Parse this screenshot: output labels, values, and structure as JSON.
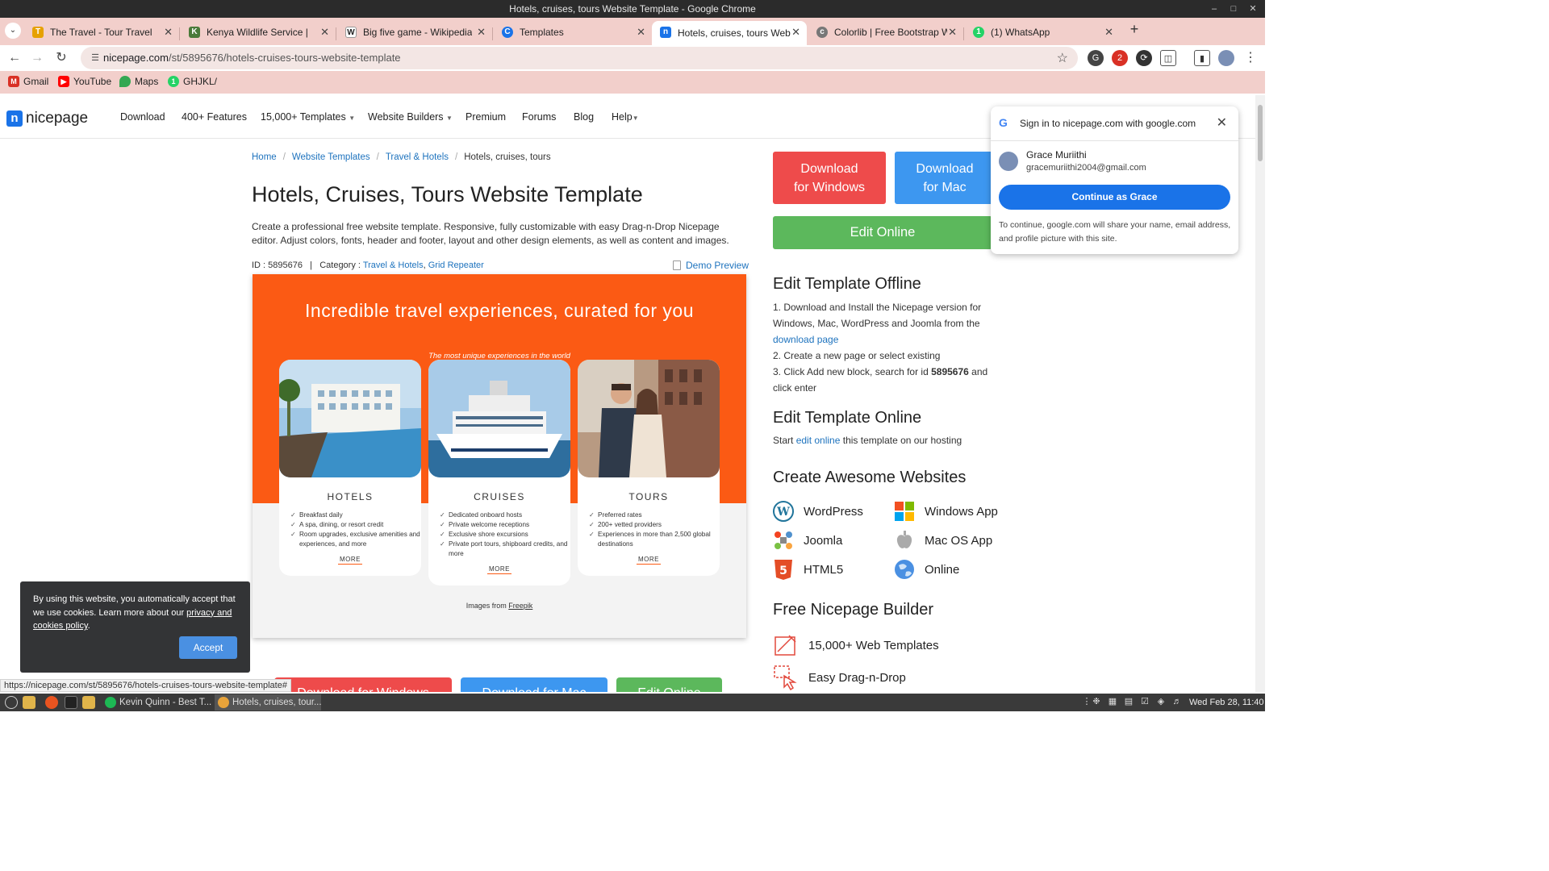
{
  "window": {
    "title": "Hotels, cruises, tours Website Template - Google Chrome"
  },
  "tabs": [
    {
      "label": "The Travel - Tour Travel",
      "favicon": "travel-icon",
      "color": "#e6a100"
    },
    {
      "label": "Kenya Wildlife Service |",
      "favicon": "kws-icon",
      "color": "#4a7a3a"
    },
    {
      "label": "Big five game - Wikipedia",
      "favicon": "wikipedia-icon",
      "color": "#222222"
    },
    {
      "label": "Templates",
      "favicon": "templates-icon",
      "color": "#1a73e8"
    },
    {
      "label": "Hotels, cruises, tours Websit",
      "favicon": "nicepage-icon",
      "color": "#1a73e8",
      "active": true
    },
    {
      "label": "Colorlib | Free Bootstrap We",
      "favicon": "colorlib-icon",
      "color": "#777777"
    },
    {
      "label": "(1) WhatsApp",
      "favicon": "whatsapp-icon",
      "color": "#25d366"
    }
  ],
  "toolbar": {
    "url_host": "nicepage.com",
    "url_path": "/st/5895676/hotels-cruises-tours-website-template",
    "extension_badge": "2"
  },
  "bookmarks": [
    {
      "label": "Gmail",
      "icon": "gmail-icon",
      "color": "#d93025"
    },
    {
      "label": "YouTube",
      "icon": "youtube-icon",
      "color": "#ff0000"
    },
    {
      "label": "Maps",
      "icon": "maps-icon",
      "color": "#34a853"
    },
    {
      "label": "GHJKL/",
      "icon": "whatsapp-icon",
      "color": "#25d366"
    }
  ],
  "site": {
    "logo_text": "nicepage",
    "logo_mark": "n",
    "nav": [
      {
        "label": "Download"
      },
      {
        "label": "400+ Features"
      },
      {
        "label": "15,000+ Templates"
      },
      {
        "label": "Website Builders"
      },
      {
        "label": "Premium"
      },
      {
        "label": "Forums"
      },
      {
        "label": "Blog"
      },
      {
        "label": "Help"
      }
    ]
  },
  "breadcrumb": {
    "home": "Home",
    "templates": "Website Templates",
    "category": "Travel & Hotels",
    "current": "Hotels, cruises, tours"
  },
  "page": {
    "title": "Hotels, Cruises, Tours Website Template",
    "description": "Create a professional free website template. Responsive, fully customizable with easy Drag-n-Drop Nicepage editor. Adjust colors, fonts, header and footer, layout and other design elements, as well as content and images.",
    "id_label": "ID : 5895676",
    "id_sep": "|",
    "category_label": "Category :",
    "category_1": "Travel & Hotels",
    "category_2": "Grid Repeater",
    "category_comma": ",",
    "demo_preview": "Demo Preview"
  },
  "preview": {
    "headline": "Incredible travel experiences, curated for you",
    "subline": "The most unique experiences in the world",
    "credit_prefix": "Images from ",
    "credit_link": "Freepik",
    "cards": [
      {
        "title": "HOTELS",
        "items": [
          "Breakfast daily",
          "A spa, dining, or resort credit",
          "Room upgrades, exclusive amenities and experiences, and more"
        ],
        "more": "MORE"
      },
      {
        "title": "CRUISES",
        "items": [
          "Dedicated onboard hosts",
          "Private welcome receptions",
          "Exclusive shore excursions",
          "Private port tours, shipboard credits, and more"
        ],
        "more": "MORE"
      },
      {
        "title": "TOURS",
        "items": [
          "Preferred rates",
          "200+ vetted providers",
          "Experiences in more than 2,500 global destinations"
        ],
        "more": "MORE"
      }
    ]
  },
  "bottom_buttons": {
    "windows": "Download for Windows",
    "mac": "Download for Mac",
    "online": "Edit Online"
  },
  "sidebar": {
    "download_windows_1": "Download",
    "download_windows_2": "for Windows",
    "download_mac_1": "Download",
    "download_mac_2": "for Mac",
    "edit_online": "Edit Online",
    "offline_heading": "Edit Template Offline",
    "step1": "1. Download and Install the Nicepage version for Windows, Mac, WordPress and Joomla from the",
    "step1_link": "download page",
    "step2": "2. Create a new page or select existing",
    "step3_prefix": "3. Click Add new block, search for id",
    "step3_id": "5895676",
    "step3_suffix": "and click enter",
    "online_heading": "Edit Template Online",
    "online_prefix": "Start",
    "online_link": "edit online",
    "online_suffix": "this template on our hosting",
    "awesome_heading": "Create Awesome Websites",
    "platforms": [
      {
        "label": "WordPress",
        "icon": "wordpress-icon"
      },
      {
        "label": "Windows App",
        "icon": "windows-icon"
      },
      {
        "label": "Joomla",
        "icon": "joomla-icon"
      },
      {
        "label": "Mac OS App",
        "icon": "apple-icon"
      },
      {
        "label": "HTML5",
        "icon": "html5-icon"
      },
      {
        "label": "Online",
        "icon": "globe-icon"
      }
    ],
    "builder_heading": "Free Nicepage Builder",
    "features": [
      {
        "label": "15,000+ Web Templates",
        "icon": "templates-icon"
      },
      {
        "label": "Easy Drag-n-Drop",
        "icon": "drag-drop-icon"
      }
    ]
  },
  "cookie": {
    "text": "By using this website, you automatically accept that we use cookies. Learn more about our ",
    "link": "privacy and cookies policy",
    "end": ".",
    "accept": "Accept"
  },
  "google_popup": {
    "title": "Sign in to nicepage.com with google.com",
    "name": "Grace Muriithi",
    "email": "gracemuriithi2004@gmail.com",
    "button": "Continue as Grace",
    "note": "To continue, google.com will share your name, email address, and profile picture with this site."
  },
  "hover_url": "https://nicepage.com/st/5895676/hotels-cruises-tours-website-template#",
  "taskbar": {
    "tasks": [
      {
        "label": "Kevin Quinn - Best T...",
        "icon": "spotify-icon",
        "color": "#1db954"
      },
      {
        "label": "Hotels, cruises, tour...",
        "icon": "chrome-icon",
        "color": "#e8a33a",
        "active": true
      }
    ],
    "clock": "Wed Feb 28, 11:40"
  },
  "colors": {
    "accent_orange": "#fb5a14",
    "download_red": "#ee4b4b",
    "download_blue": "#3d97f0",
    "edit_green": "#5cb85c",
    "link_blue": "#1e73be",
    "tab_strip": "#f2cfcb"
  }
}
